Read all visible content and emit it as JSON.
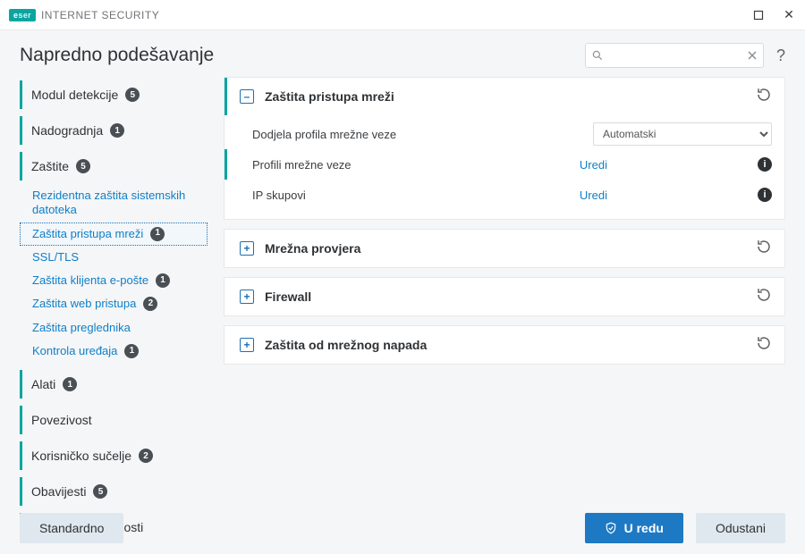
{
  "brand": {
    "badge": "e",
    "badge_sub": "ser",
    "name": "INTERNET SECURITY"
  },
  "window": {
    "maximize_glyph": "☐??",
    "close_glyph": "✕"
  },
  "header": {
    "title": "Napredno podešavanje",
    "search_placeholder": "",
    "help_glyph": "?"
  },
  "sidebar": {
    "items": [
      {
        "label": "Modul detekcije",
        "badge": "5"
      },
      {
        "label": "Nadogradnja",
        "badge": "1"
      },
      {
        "label": "Zaštite",
        "badge": "5",
        "children": [
          {
            "label": "Rezidentna zaštita sistemskih datoteka",
            "badge": null,
            "selected": false,
            "multiline": true
          },
          {
            "label": "Zaštita pristupa mreži",
            "badge": "1",
            "selected": true
          },
          {
            "label": "SSL/TLS",
            "badge": null
          },
          {
            "label": "Zaštita klijenta e-pošte",
            "badge": "1"
          },
          {
            "label": "Zaštita web pristupa",
            "badge": "2"
          },
          {
            "label": "Zaštita preglednika",
            "badge": null
          },
          {
            "label": "Kontrola uređaja",
            "badge": "1"
          }
        ]
      },
      {
        "label": "Alati",
        "badge": "1"
      },
      {
        "label": "Povezivost",
        "badge": null
      },
      {
        "label": "Korisničko sučelje",
        "badge": "2"
      },
      {
        "label": "Obavijesti",
        "badge": "5"
      },
      {
        "label": "Postavke privatnosti",
        "badge": null
      }
    ]
  },
  "panels": {
    "network_access": {
      "title": "Zaštita pristupa mreži",
      "rows": {
        "profile_assign": {
          "label": "Dodjela profila mrežne veze",
          "value": "Automatski"
        },
        "profiles": {
          "label": "Profili mrežne veze",
          "action": "Uredi"
        },
        "ip_sets": {
          "label": "IP skupovi",
          "action": "Uredi"
        }
      }
    },
    "network_check": {
      "title": "Mrežna provjera"
    },
    "firewall": {
      "title": "Firewall"
    },
    "net_attack": {
      "title": "Zaštita od mrežnog napada"
    }
  },
  "footer": {
    "default": "Standardno",
    "ok": "U redu",
    "cancel": "Odustani"
  }
}
